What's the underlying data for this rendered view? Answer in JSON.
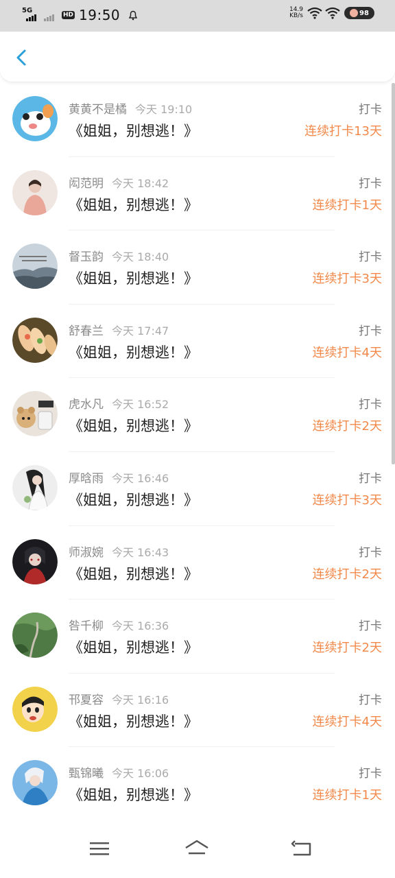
{
  "status_bar": {
    "network_label": "5G",
    "hd_label": "HD",
    "time": "19:50",
    "speed_value": "14.9",
    "speed_unit": "KB/s",
    "battery": "98"
  },
  "colors": {
    "accent": "#2b9fd9",
    "streak": "#f2894a"
  },
  "entries": [
    {
      "name": "黄黄不是橘",
      "time": "今天 19:10",
      "title": "《姐姐，别想逃！》",
      "action": "打卡",
      "streak": "连续打卡13天"
    },
    {
      "name": "闳范明",
      "time": "今天 18:42",
      "title": "《姐姐，别想逃！》",
      "action": "打卡",
      "streak": "连续打卡1天"
    },
    {
      "name": "督玉韵",
      "time": "今天 18:40",
      "title": "《姐姐，别想逃！》",
      "action": "打卡",
      "streak": "连续打卡3天"
    },
    {
      "name": "舒春兰",
      "time": "今天 17:47",
      "title": "《姐姐，别想逃！》",
      "action": "打卡",
      "streak": "连续打卡4天"
    },
    {
      "name": "虎水凡",
      "time": "今天 16:52",
      "title": "《姐姐，别想逃！》",
      "action": "打卡",
      "streak": "连续打卡2天"
    },
    {
      "name": "厚晗雨",
      "time": "今天 16:46",
      "title": "《姐姐，别想逃！》",
      "action": "打卡",
      "streak": "连续打卡3天"
    },
    {
      "name": "师淑婉",
      "time": "今天 16:43",
      "title": "《姐姐，别想逃！》",
      "action": "打卡",
      "streak": "连续打卡2天"
    },
    {
      "name": "咎千柳",
      "time": "今天 16:36",
      "title": "《姐姐，别想逃！》",
      "action": "打卡",
      "streak": "连续打卡2天"
    },
    {
      "name": "邗夏容",
      "time": "今天 16:16",
      "title": "《姐姐，别想逃！》",
      "action": "打卡",
      "streak": "连续打卡4天"
    },
    {
      "name": "甄锦曦",
      "time": "今天 16:06",
      "title": "《姐姐，别想逃！》",
      "action": "打卡",
      "streak": "连续打卡1天"
    }
  ]
}
